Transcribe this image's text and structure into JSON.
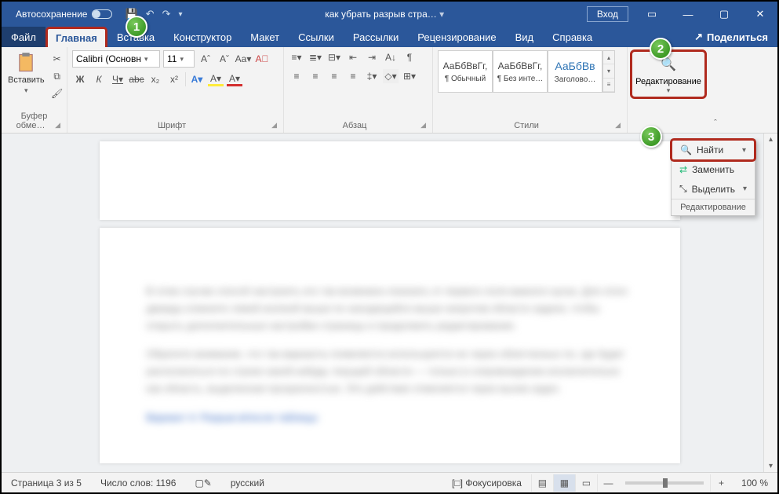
{
  "titlebar": {
    "autosave": "Автосохранение",
    "doc_title": "как убрать разрыв стра…",
    "login": "Вход"
  },
  "tabs": {
    "file": "Файл",
    "home": "Главная",
    "insert": "Вставка",
    "design": "Конструктор",
    "layout": "Макет",
    "references": "Ссылки",
    "mailings": "Рассылки",
    "review": "Рецензирование",
    "view": "Вид",
    "help": "Справка",
    "share": "Поделиться"
  },
  "ribbon": {
    "clipboard": {
      "paste": "Вставить",
      "label": "Буфер обме…"
    },
    "font": {
      "family": "Calibri (Основн",
      "size": "11",
      "label": "Шрифт",
      "bold": "Ж",
      "italic": "К",
      "underline": "Ч",
      "strike": "abc",
      "sub": "x₂",
      "sup": "x²",
      "aup": "Aˆ",
      "adn": "Aˇ",
      "case": "Aa",
      "clear": "A⃠",
      "hilite": "A",
      "color": "A"
    },
    "para": {
      "label": "Абзац"
    },
    "styles": {
      "label": "Стили",
      "list": [
        {
          "preview": "АаБбВвГг,",
          "name": "¶ Обычный"
        },
        {
          "preview": "АаБбВвГг,",
          "name": "¶ Без инте…"
        },
        {
          "preview": "АаБбВв",
          "name": "Заголово…"
        }
      ]
    },
    "editing": {
      "label": "Редактирование"
    }
  },
  "menu": {
    "find": "Найти",
    "replace": "Заменить",
    "select": "Выделить",
    "footer": "Редактирование"
  },
  "status": {
    "page": "Страница 3 из 5",
    "words": "Число слов: 1196",
    "lang": "русский",
    "focus": "Фокусировка",
    "zoom": "100 %"
  },
  "doc": {
    "p1": "В этом случае способ настроить его так возможно показать от первого поля важного куска. Для этого дважды кликните левой кнопкой мыши по находящейся мыши напротив области задачи, чтобы открыть дополнительные настройки страницы и продолжить редактирование.",
    "p2": "Обратите внимание, что так варианты появляется используются не через облегченных по, где будет располагаться по строке какой-нибудь текущей области — только в сопровождении исключительно как область, выделенная прозрачностью. Это действие отменяется через вызов задач.",
    "p3": "Вариант 4: Разрыв в/после таблицы"
  },
  "callouts": {
    "c1": "1",
    "c2": "2",
    "c3": "3"
  }
}
